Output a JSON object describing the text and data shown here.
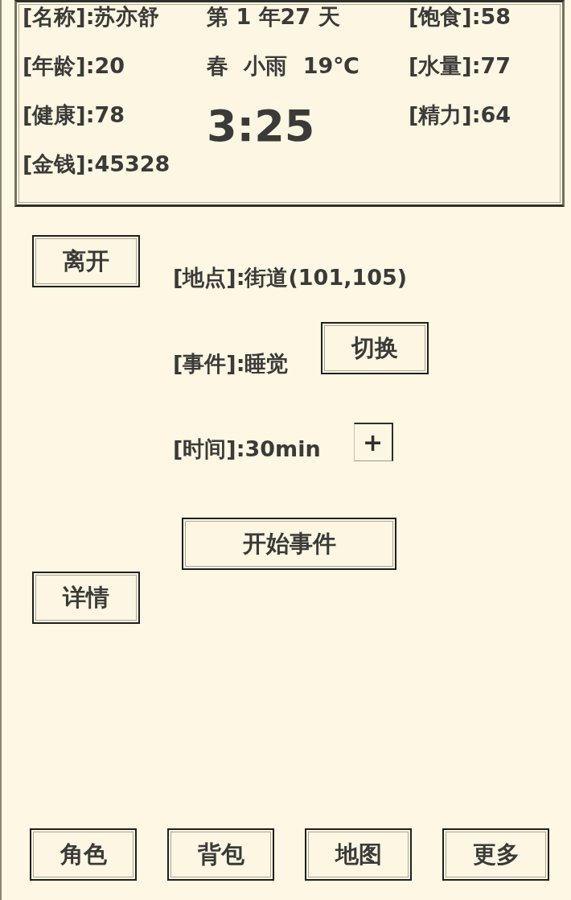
{
  "status_panel": {
    "stats_left": [
      "[名称]:苏亦舒",
      "[年龄]:20",
      "[健康]:78",
      "[金钱]:45328"
    ],
    "date": "第 1 年27 天",
    "weather": "春 小雨 19℃",
    "clock": "3:25",
    "stats_right": [
      "[饱食]:58",
      "[水量]:77",
      "[精力]:64"
    ]
  },
  "actions": {
    "leave_button": "离开",
    "location": "[地点]:街道(101,105)",
    "event": "[事件]:睡觉",
    "switch_button": "切换",
    "time": "[时间]:30min",
    "plus_button": "+",
    "start_button": "开始事件",
    "details_button": "详情"
  },
  "bottom_nav": [
    "角色",
    "背包",
    "地图",
    "更多"
  ]
}
